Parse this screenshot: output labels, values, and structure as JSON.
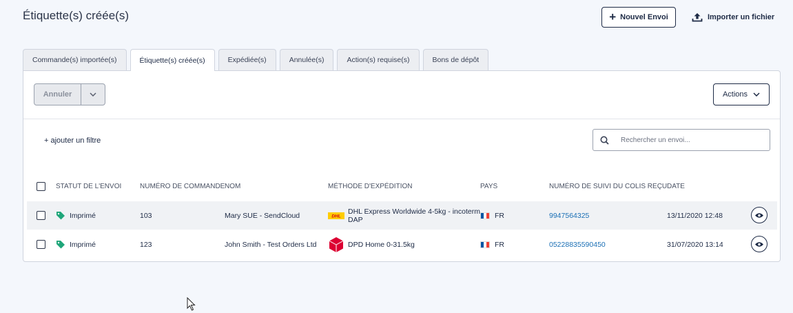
{
  "header": {
    "title": "Étiquette(s) créée(s)",
    "new_shipment_label": "Nouvel Envoi",
    "import_label": "Importer un fichier"
  },
  "tabs": [
    {
      "label": "Commande(s) importée(s)",
      "active": false
    },
    {
      "label": "Étiquette(s) créée(s)",
      "active": true
    },
    {
      "label": "Expédiée(s)",
      "active": false
    },
    {
      "label": "Annulée(s)",
      "active": false
    },
    {
      "label": "Action(s) requise(s)",
      "active": false
    },
    {
      "label": "Bons de dépôt",
      "active": false
    }
  ],
  "toolbar": {
    "cancel_label": "Annuler",
    "actions_label": "Actions",
    "add_filter_label": "+ ajouter un filtre",
    "search_placeholder": "Rechercher un envoi..."
  },
  "table": {
    "columns": [
      "STATUT DE L'ENVOI",
      "NUMÉRO DE COMMANDE",
      "NOM",
      "MÉTHODE D'EXPÉDITION",
      "PAYS",
      "NUMÉRO DE SUIVI DU COLIS REÇU",
      "DATE"
    ],
    "rows": [
      {
        "status": "Imprimé",
        "order": "103",
        "name": "Mary SUE - SendCloud",
        "method": "DHL Express Worldwide 4-5kg - incoterm DAP",
        "carrier": "dhl-logo",
        "country": "FR",
        "tracking": "9947564325",
        "date": "13/11/2020 12:48"
      },
      {
        "status": "Imprimé",
        "order": "123",
        "name": "John Smith - Test Orders Ltd",
        "method": "DPD Home 0-31.5kg",
        "carrier": "dpd-logo",
        "country": "FR",
        "tracking": "05228835590450",
        "date": "31/07/2020 13:14"
      }
    ]
  },
  "colors": {
    "primary": "#1d2a45",
    "status_tag": "#1fa67a",
    "link": "#1a6fb5",
    "dpd_red": "#dc0032",
    "dhl_yellow": "#ffcc00",
    "dhl_red": "#d40511"
  }
}
